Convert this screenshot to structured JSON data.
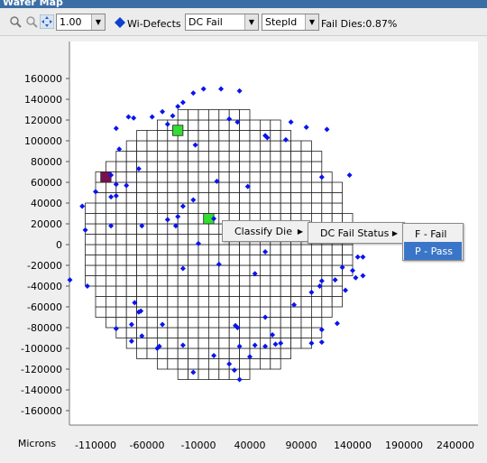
{
  "window": {
    "title": "Wafer Map"
  },
  "toolbar": {
    "zoom_value": "1.00",
    "defect_label": "Wi-Defects",
    "metric_value": "DC Fail",
    "group_value": "StepId",
    "fail_dies": "Fail Dies:0.87%"
  },
  "context_menu": {
    "item": "Classify Die",
    "submenu_item": "DC Fail Status",
    "options": [
      "F - Fail",
      "P - Pass"
    ],
    "selected": "P - Pass"
  },
  "chart_data": {
    "type": "scatter",
    "xlabel": "Microns",
    "x_ticks": [
      "-110000",
      "-60000",
      "-10000",
      "40000",
      "90000",
      "140000",
      "190000",
      "240000"
    ],
    "y_ticks": [
      "160000",
      "140000",
      "120000",
      "100000",
      "80000",
      "60000",
      "40000",
      "20000",
      "0",
      "-20000",
      "-40000",
      "-60000",
      "-80000",
      "-100000",
      "-120000",
      "-140000",
      "-160000"
    ],
    "xlim": [
      -135000,
      265000
    ],
    "ylim": [
      -175000,
      175000
    ],
    "die_width": 10000,
    "die_height": 10000,
    "wafer_center": [
      7500,
      0
    ],
    "wafer_radius": 130000,
    "highlighted_dies": [
      {
        "x": -105000,
        "y": 60000,
        "color": "#7a1050"
      },
      {
        "x": -35000,
        "y": 105000,
        "color": "#33dd33"
      },
      {
        "x": -5000,
        "y": 20000,
        "color": "#33dd33"
      }
    ],
    "defect_color": "#0a14ee",
    "defects": [
      [
        -5000,
        150000
      ],
      [
        12000,
        150000
      ],
      [
        30000,
        148000
      ],
      [
        -15000,
        146000
      ],
      [
        -25000,
        137000
      ],
      [
        -30000,
        133000
      ],
      [
        -45000,
        128000
      ],
      [
        -35000,
        124000
      ],
      [
        -55000,
        123000
      ],
      [
        -78000,
        123000
      ],
      [
        -73000,
        122000
      ],
      [
        -90000,
        112000
      ],
      [
        -40000,
        116000
      ],
      [
        20000,
        121000
      ],
      [
        28000,
        118000
      ],
      [
        55000,
        105000
      ],
      [
        57000,
        103000
      ],
      [
        80000,
        118000
      ],
      [
        95000,
        113000
      ],
      [
        115000,
        111000
      ],
      [
        75000,
        101000
      ],
      [
        -13000,
        96000
      ],
      [
        -87000,
        92000
      ],
      [
        -68000,
        73000
      ],
      [
        -95000,
        67000
      ],
      [
        -80000,
        57000
      ],
      [
        -90000,
        58000
      ],
      [
        38000,
        56000
      ],
      [
        8000,
        61000
      ],
      [
        137000,
        67000
      ],
      [
        110000,
        65000
      ],
      [
        -90000,
        47000
      ],
      [
        -95000,
        46000
      ],
      [
        -110000,
        51000
      ],
      [
        -123000,
        37000
      ],
      [
        -25000,
        37000
      ],
      [
        -15000,
        43000
      ],
      [
        -30000,
        27000
      ],
      [
        -40000,
        24000
      ],
      [
        -32000,
        18000
      ],
      [
        -65000,
        18000
      ],
      [
        -95000,
        18000
      ],
      [
        -120000,
        14000
      ],
      [
        5000,
        25000
      ],
      [
        -10000,
        1000
      ],
      [
        55000,
        -7000
      ],
      [
        145000,
        -12000
      ],
      [
        150000,
        -12000
      ],
      [
        10000,
        -19000
      ],
      [
        130000,
        -22000
      ],
      [
        140000,
        -25000
      ],
      [
        -25000,
        -23000
      ],
      [
        45000,
        -28000
      ],
      [
        150000,
        -30000
      ],
      [
        143000,
        -32000
      ],
      [
        123000,
        -34000
      ],
      [
        110000,
        -35000
      ],
      [
        108000,
        -40000
      ],
      [
        -135000,
        -34000
      ],
      [
        -118000,
        -40000
      ],
      [
        133000,
        -44000
      ],
      [
        100000,
        -46000
      ],
      [
        -72000,
        -56000
      ],
      [
        -68000,
        -65000
      ],
      [
        -66000,
        -64000
      ],
      [
        -75000,
        -77000
      ],
      [
        83000,
        -58000
      ],
      [
        55000,
        -70000
      ],
      [
        125000,
        -76000
      ],
      [
        110000,
        -82000
      ],
      [
        -90000,
        -81000
      ],
      [
        -45000,
        -77000
      ],
      [
        26000,
        -78000
      ],
      [
        28000,
        -80000
      ],
      [
        -65000,
        -88000
      ],
      [
        62000,
        -87000
      ],
      [
        55000,
        -98000
      ],
      [
        45000,
        -97000
      ],
      [
        70000,
        -95000
      ],
      [
        65000,
        -96000
      ],
      [
        100000,
        -95000
      ],
      [
        110000,
        -94000
      ],
      [
        -75000,
        -93000
      ],
      [
        -48000,
        -98000
      ],
      [
        -50000,
        -100000
      ],
      [
        -25000,
        -97000
      ],
      [
        30000,
        -98000
      ],
      [
        5000,
        -107000
      ],
      [
        40000,
        -108000
      ],
      [
        -15000,
        -123000
      ],
      [
        20000,
        -115000
      ],
      [
        25000,
        -121000
      ],
      [
        30000,
        -130000
      ]
    ]
  }
}
